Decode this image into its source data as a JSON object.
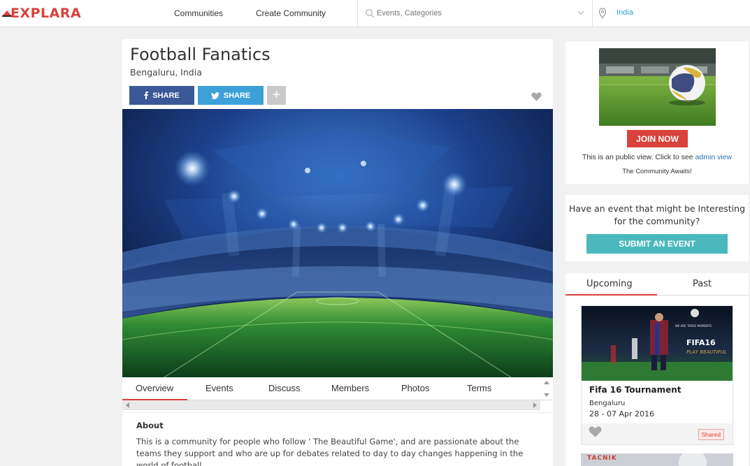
{
  "header": {
    "logo": "EXPLARA",
    "nav": [
      "Communities",
      "Create Community"
    ],
    "search_placeholder": "Events, Categories",
    "location": "India"
  },
  "community": {
    "title": "Football Fanatics",
    "location": "Bengaluru, India",
    "share_fb": "SHARE",
    "share_tw": "SHARE",
    "plus": "+"
  },
  "tabs": [
    "Overview",
    "Events",
    "Discuss",
    "Members",
    "Photos",
    "Terms"
  ],
  "about": {
    "heading": "About",
    "text": "This is a community for people who follow ' The Beautiful Game', and are passionate about the teams they support and who are up for debates related to day to day changes happening in the world of football."
  },
  "sidebar": {
    "join_label": "JOIN NOW",
    "public_text": "This is an public view. Click to see",
    "admin_link": "admin view",
    "awaits": "The Community Awaits!",
    "have_event": "Have an event that might be Interesting for the community?",
    "submit_label": "SUBMIT AN EVENT",
    "tab_upcoming": "Upcoming",
    "tab_past": "Past",
    "event": {
      "title": "Fifa 16 Tournament",
      "city": "Bengaluru",
      "date": "28 - 07 Apr 2016",
      "badge": "Shared",
      "poster_text": "FIFA16",
      "poster_sub": "PLAY BEAUTIFUL",
      "poster_top": "WE ARE THREE MOMENTS"
    },
    "event2_label": "TACNIK"
  },
  "colors": {
    "brand": "#d9423a",
    "facebook": "#3b5998",
    "twitter": "#3ea0d9",
    "teal": "#4ab9bd",
    "link": "#2f6fb0"
  }
}
